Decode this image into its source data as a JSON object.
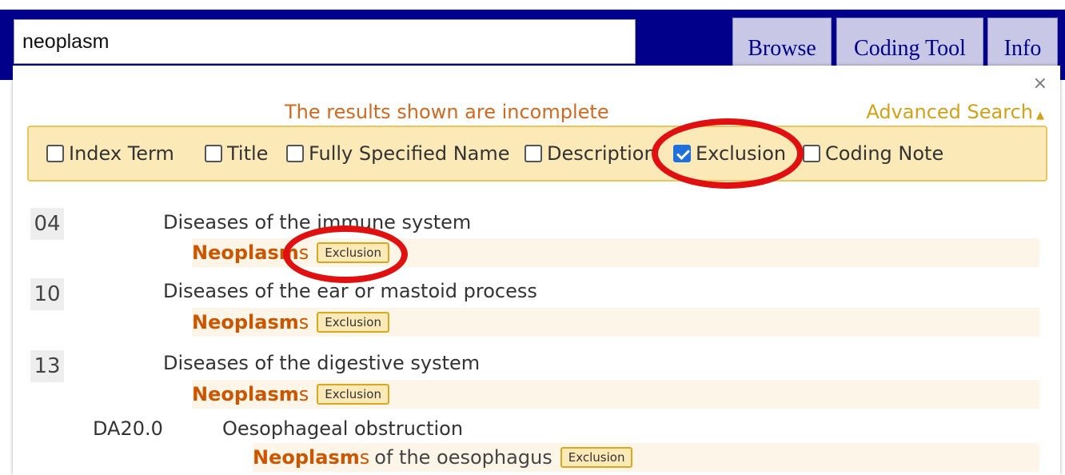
{
  "search": {
    "value": "neoplasm"
  },
  "tabs": [
    {
      "label": "Browse"
    },
    {
      "label": "Coding Tool"
    },
    {
      "label": "Info"
    }
  ],
  "panel": {
    "close_label": "×",
    "incomplete_notice": "The results shown are incomplete",
    "advanced_search_label": "Advanced Search",
    "advanced_search_arrow": "▲"
  },
  "filters": [
    {
      "label": "Index Term",
      "checked": false
    },
    {
      "label": "Title",
      "checked": false
    },
    {
      "label": "Fully Specified Name",
      "checked": false
    },
    {
      "label": "Description",
      "checked": false
    },
    {
      "label": "Exclusion",
      "checked": true
    },
    {
      "label": "Coding Note",
      "checked": false
    }
  ],
  "results": [
    {
      "code": "04",
      "title": "Diseases of the immune system",
      "match": {
        "hl": "Neoplasm",
        "suffix": "s",
        "rest": "",
        "badge": "Exclusion"
      }
    },
    {
      "code": "10",
      "title": "Diseases of the ear or mastoid process",
      "match": {
        "hl": "Neoplasm",
        "suffix": "s",
        "rest": "",
        "badge": "Exclusion"
      }
    },
    {
      "code": "13",
      "title": "Diseases of the digestive system",
      "match": {
        "hl": "Neoplasm",
        "suffix": "s",
        "rest": "",
        "badge": "Exclusion"
      }
    },
    {
      "code": "DA20.0",
      "title": "Oesophageal obstruction",
      "match": {
        "hl": "Neoplasm",
        "suffix": "s",
        "rest": "of the oesophagus",
        "badge": "Exclusion"
      }
    }
  ],
  "colors": {
    "header_bg": "#00008b",
    "highlight": "#cc5500",
    "annotation_ring": "#e01010",
    "filter_bar_bg": "#fbe9b7"
  }
}
